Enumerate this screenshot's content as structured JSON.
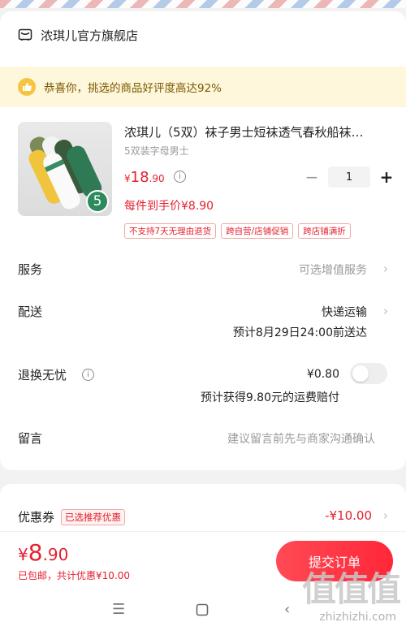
{
  "shop": {
    "name": "浓琪儿官方旗舰店",
    "icon": "shop-icon"
  },
  "tip": {
    "text": "恭喜你，挑选的商品好评度高达92%",
    "icon": "thumbs-up-icon",
    "accent": "#f5c542"
  },
  "product": {
    "title": "浓琪儿（5双）袜子男士短袜透气春秋船袜…",
    "spec": "5双装字母男士",
    "price_symbol": "¥",
    "price_int": "18",
    "price_dec": ".90",
    "deal": "每件到手价¥8.90",
    "quantity": "1",
    "badge": "5",
    "tags": [
      "不支持7天无理由退货",
      "跨自营/店铺促销",
      "跨店铺满折"
    ]
  },
  "rows": {
    "service": {
      "label": "服务",
      "value": "可选增值服务"
    },
    "delivery": {
      "label": "配送",
      "value": "快递运输",
      "eta": "预计8月29日24:00前送达"
    },
    "return": {
      "label": "退换无忧",
      "price": "¥0.80",
      "note": "预计获得9.80元的运费赔付"
    },
    "message": {
      "label": "留言",
      "placeholder": "建议留言前先与商家沟通确认"
    }
  },
  "coupon": {
    "label": "优惠券",
    "tag": "已选推荐优惠",
    "amount": "-¥10.00"
  },
  "summary": {
    "total_symbol": "¥",
    "total_int": "8",
    "total_dec": ".90",
    "note": "已包邮，共计优惠¥10.00",
    "submit": "提交订单"
  },
  "watermark": {
    "text": "值值值",
    "url": "zhizhizhi.com"
  },
  "colors": {
    "accent": "#e5202f",
    "tip_bg": "#fff7dc",
    "badge": "#2c8a5c"
  }
}
